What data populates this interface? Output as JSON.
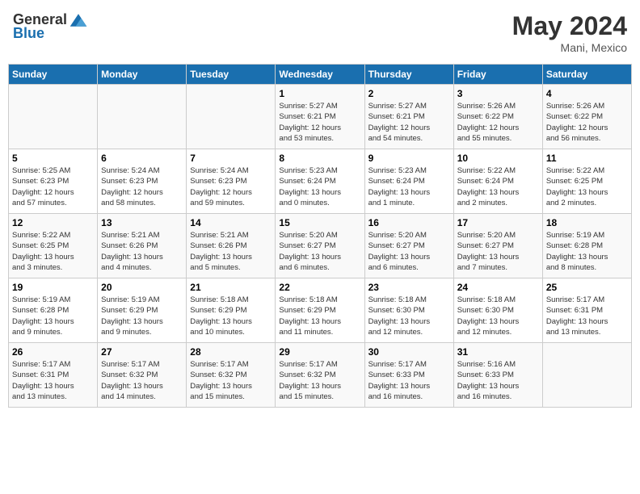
{
  "header": {
    "logo_general": "General",
    "logo_blue": "Blue",
    "month_year": "May 2024",
    "location": "Mani, Mexico"
  },
  "weekdays": [
    "Sunday",
    "Monday",
    "Tuesday",
    "Wednesday",
    "Thursday",
    "Friday",
    "Saturday"
  ],
  "weeks": [
    [
      {
        "day": "",
        "info": ""
      },
      {
        "day": "",
        "info": ""
      },
      {
        "day": "",
        "info": ""
      },
      {
        "day": "1",
        "info": "Sunrise: 5:27 AM\nSunset: 6:21 PM\nDaylight: 12 hours\nand 53 minutes."
      },
      {
        "day": "2",
        "info": "Sunrise: 5:27 AM\nSunset: 6:21 PM\nDaylight: 12 hours\nand 54 minutes."
      },
      {
        "day": "3",
        "info": "Sunrise: 5:26 AM\nSunset: 6:22 PM\nDaylight: 12 hours\nand 55 minutes."
      },
      {
        "day": "4",
        "info": "Sunrise: 5:26 AM\nSunset: 6:22 PM\nDaylight: 12 hours\nand 56 minutes."
      }
    ],
    [
      {
        "day": "5",
        "info": "Sunrise: 5:25 AM\nSunset: 6:23 PM\nDaylight: 12 hours\nand 57 minutes."
      },
      {
        "day": "6",
        "info": "Sunrise: 5:24 AM\nSunset: 6:23 PM\nDaylight: 12 hours\nand 58 minutes."
      },
      {
        "day": "7",
        "info": "Sunrise: 5:24 AM\nSunset: 6:23 PM\nDaylight: 12 hours\nand 59 minutes."
      },
      {
        "day": "8",
        "info": "Sunrise: 5:23 AM\nSunset: 6:24 PM\nDaylight: 13 hours\nand 0 minutes."
      },
      {
        "day": "9",
        "info": "Sunrise: 5:23 AM\nSunset: 6:24 PM\nDaylight: 13 hours\nand 1 minute."
      },
      {
        "day": "10",
        "info": "Sunrise: 5:22 AM\nSunset: 6:24 PM\nDaylight: 13 hours\nand 2 minutes."
      },
      {
        "day": "11",
        "info": "Sunrise: 5:22 AM\nSunset: 6:25 PM\nDaylight: 13 hours\nand 2 minutes."
      }
    ],
    [
      {
        "day": "12",
        "info": "Sunrise: 5:22 AM\nSunset: 6:25 PM\nDaylight: 13 hours\nand 3 minutes."
      },
      {
        "day": "13",
        "info": "Sunrise: 5:21 AM\nSunset: 6:26 PM\nDaylight: 13 hours\nand 4 minutes."
      },
      {
        "day": "14",
        "info": "Sunrise: 5:21 AM\nSunset: 6:26 PM\nDaylight: 13 hours\nand 5 minutes."
      },
      {
        "day": "15",
        "info": "Sunrise: 5:20 AM\nSunset: 6:27 PM\nDaylight: 13 hours\nand 6 minutes."
      },
      {
        "day": "16",
        "info": "Sunrise: 5:20 AM\nSunset: 6:27 PM\nDaylight: 13 hours\nand 6 minutes."
      },
      {
        "day": "17",
        "info": "Sunrise: 5:20 AM\nSunset: 6:27 PM\nDaylight: 13 hours\nand 7 minutes."
      },
      {
        "day": "18",
        "info": "Sunrise: 5:19 AM\nSunset: 6:28 PM\nDaylight: 13 hours\nand 8 minutes."
      }
    ],
    [
      {
        "day": "19",
        "info": "Sunrise: 5:19 AM\nSunset: 6:28 PM\nDaylight: 13 hours\nand 9 minutes."
      },
      {
        "day": "20",
        "info": "Sunrise: 5:19 AM\nSunset: 6:29 PM\nDaylight: 13 hours\nand 9 minutes."
      },
      {
        "day": "21",
        "info": "Sunrise: 5:18 AM\nSunset: 6:29 PM\nDaylight: 13 hours\nand 10 minutes."
      },
      {
        "day": "22",
        "info": "Sunrise: 5:18 AM\nSunset: 6:29 PM\nDaylight: 13 hours\nand 11 minutes."
      },
      {
        "day": "23",
        "info": "Sunrise: 5:18 AM\nSunset: 6:30 PM\nDaylight: 13 hours\nand 12 minutes."
      },
      {
        "day": "24",
        "info": "Sunrise: 5:18 AM\nSunset: 6:30 PM\nDaylight: 13 hours\nand 12 minutes."
      },
      {
        "day": "25",
        "info": "Sunrise: 5:17 AM\nSunset: 6:31 PM\nDaylight: 13 hours\nand 13 minutes."
      }
    ],
    [
      {
        "day": "26",
        "info": "Sunrise: 5:17 AM\nSunset: 6:31 PM\nDaylight: 13 hours\nand 13 minutes."
      },
      {
        "day": "27",
        "info": "Sunrise: 5:17 AM\nSunset: 6:32 PM\nDaylight: 13 hours\nand 14 minutes."
      },
      {
        "day": "28",
        "info": "Sunrise: 5:17 AM\nSunset: 6:32 PM\nDaylight: 13 hours\nand 15 minutes."
      },
      {
        "day": "29",
        "info": "Sunrise: 5:17 AM\nSunset: 6:32 PM\nDaylight: 13 hours\nand 15 minutes."
      },
      {
        "day": "30",
        "info": "Sunrise: 5:17 AM\nSunset: 6:33 PM\nDaylight: 13 hours\nand 16 minutes."
      },
      {
        "day": "31",
        "info": "Sunrise: 5:16 AM\nSunset: 6:33 PM\nDaylight: 13 hours\nand 16 minutes."
      },
      {
        "day": "",
        "info": ""
      }
    ]
  ]
}
